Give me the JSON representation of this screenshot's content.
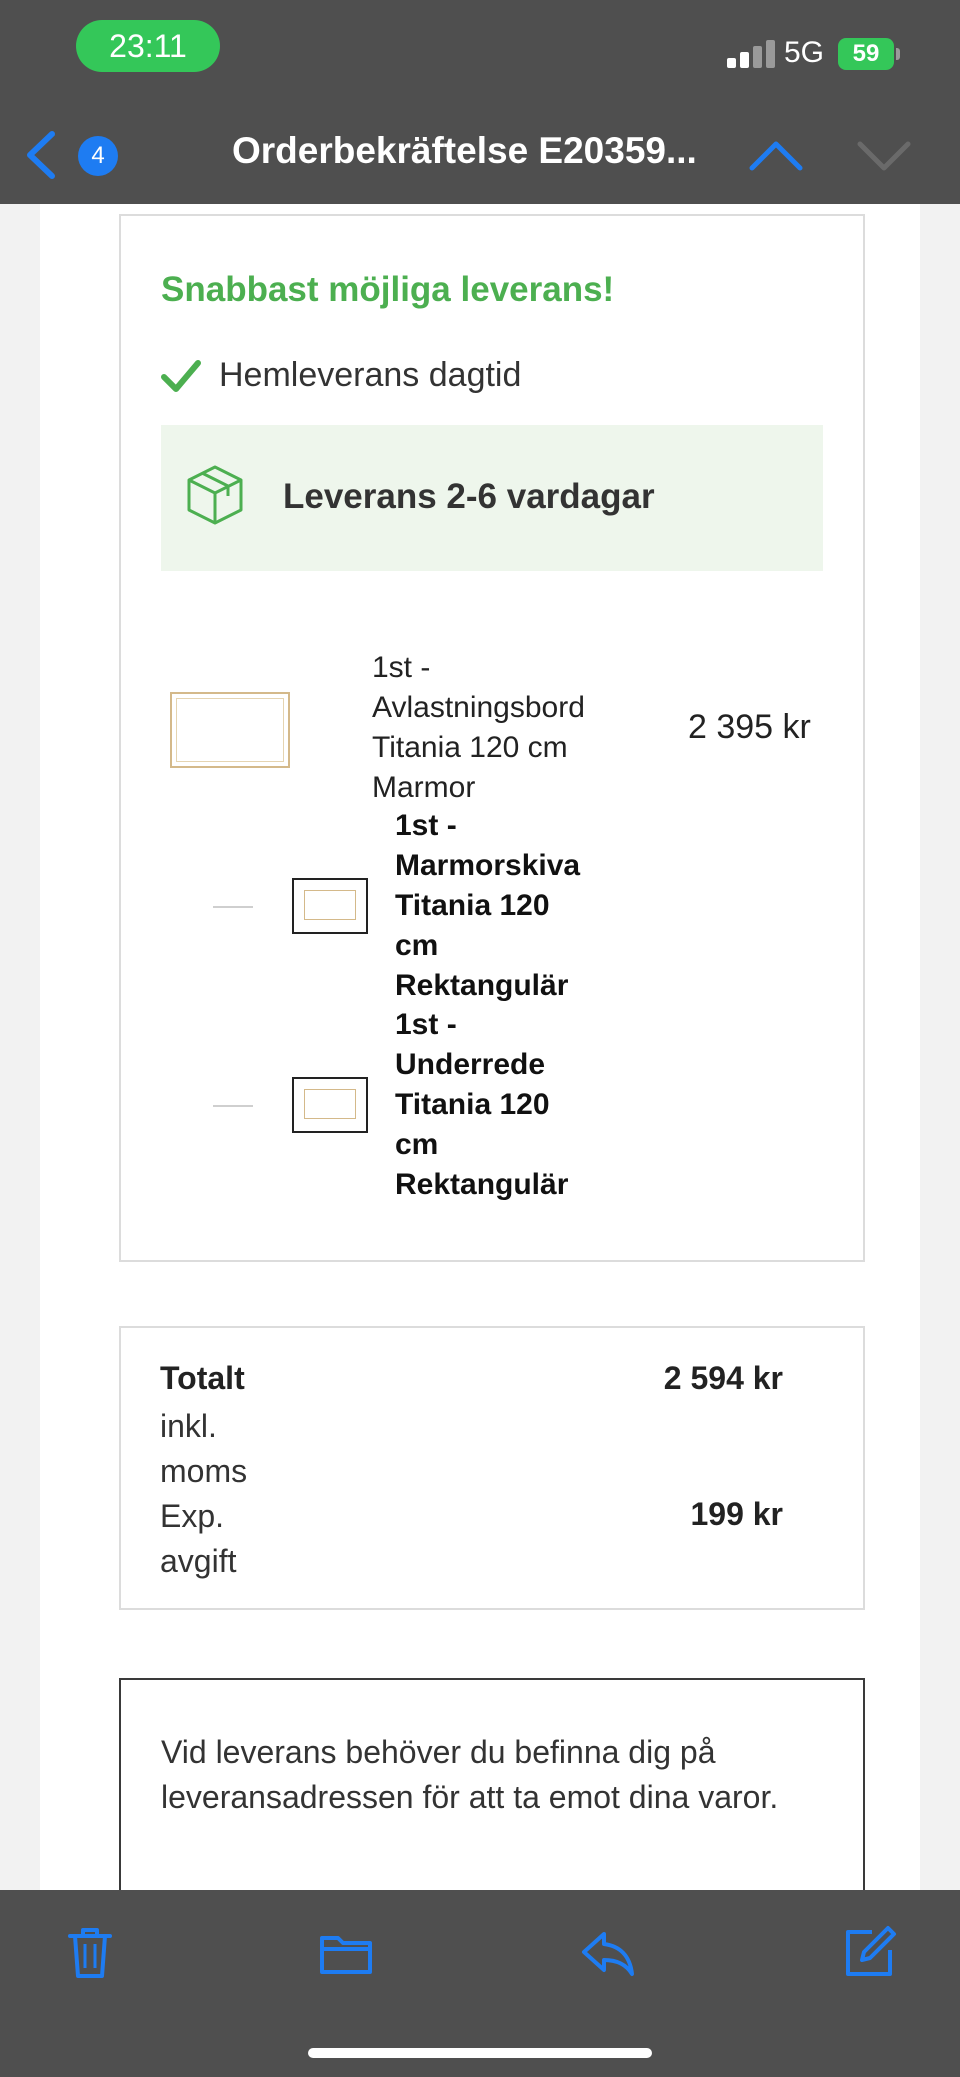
{
  "status_bar": {
    "time": "23:11",
    "network": "5G",
    "battery": "59",
    "colors": {
      "time_pill": "#34c759",
      "battery": "#34c759"
    }
  },
  "nav": {
    "back_icon": "chevron-left-icon",
    "unread_count": "4",
    "title": "Orderbekräftelse E20359...",
    "prev_icon": "chevron-up-icon",
    "next_icon": "chevron-down-icon",
    "accent": "#1e7cf2"
  },
  "delivery": {
    "promo": "Snabbast möjliga leverans!",
    "method": "Hemleverans dagtid",
    "window": "Leverans 2-6 vardagar",
    "colors": {
      "promo": "#4caf50",
      "box_bg": "#eef6ec"
    }
  },
  "items": {
    "main": {
      "lines": [
        "1st -",
        "Avlastningsbord",
        "Titania 120 cm",
        "Marmor"
      ],
      "price": "2 395 kr"
    },
    "sub": [
      {
        "lines": [
          "1st -",
          "Marmorskiva",
          "Titania 120",
          "cm",
          "Rektangulär"
        ]
      },
      {
        "lines": [
          "1st -",
          "Underrede",
          "Titania 120",
          "cm",
          "Rektangulär"
        ]
      }
    ]
  },
  "totals": {
    "total_label": "Totalt",
    "total_sub_lines": [
      "inkl.",
      "moms"
    ],
    "total_value": "2 594 kr",
    "fee_lines": [
      "Exp.",
      "avgift"
    ],
    "fee_value": "199 kr"
  },
  "notice": {
    "text": "Vid leverans behöver du befinna dig på leveransadressen för att ta emot dina varor."
  },
  "toolbar": {
    "icons": [
      "trash-icon",
      "folder-icon",
      "reply-icon",
      "compose-icon"
    ]
  }
}
